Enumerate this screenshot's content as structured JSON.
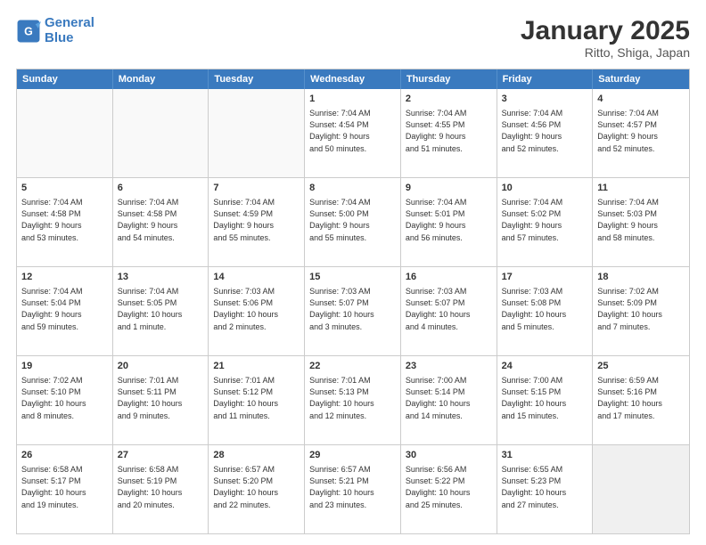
{
  "header": {
    "logo_line1": "General",
    "logo_line2": "Blue",
    "title": "January 2025",
    "subtitle": "Ritto, Shiga, Japan"
  },
  "weekdays": [
    "Sunday",
    "Monday",
    "Tuesday",
    "Wednesday",
    "Thursday",
    "Friday",
    "Saturday"
  ],
  "rows": [
    [
      {
        "day": "",
        "text": "",
        "empty": true
      },
      {
        "day": "",
        "text": "",
        "empty": true
      },
      {
        "day": "",
        "text": "",
        "empty": true
      },
      {
        "day": "1",
        "text": "Sunrise: 7:04 AM\nSunset: 4:54 PM\nDaylight: 9 hours\nand 50 minutes."
      },
      {
        "day": "2",
        "text": "Sunrise: 7:04 AM\nSunset: 4:55 PM\nDaylight: 9 hours\nand 51 minutes."
      },
      {
        "day": "3",
        "text": "Sunrise: 7:04 AM\nSunset: 4:56 PM\nDaylight: 9 hours\nand 52 minutes."
      },
      {
        "day": "4",
        "text": "Sunrise: 7:04 AM\nSunset: 4:57 PM\nDaylight: 9 hours\nand 52 minutes."
      }
    ],
    [
      {
        "day": "5",
        "text": "Sunrise: 7:04 AM\nSunset: 4:58 PM\nDaylight: 9 hours\nand 53 minutes."
      },
      {
        "day": "6",
        "text": "Sunrise: 7:04 AM\nSunset: 4:58 PM\nDaylight: 9 hours\nand 54 minutes."
      },
      {
        "day": "7",
        "text": "Sunrise: 7:04 AM\nSunset: 4:59 PM\nDaylight: 9 hours\nand 55 minutes."
      },
      {
        "day": "8",
        "text": "Sunrise: 7:04 AM\nSunset: 5:00 PM\nDaylight: 9 hours\nand 55 minutes."
      },
      {
        "day": "9",
        "text": "Sunrise: 7:04 AM\nSunset: 5:01 PM\nDaylight: 9 hours\nand 56 minutes."
      },
      {
        "day": "10",
        "text": "Sunrise: 7:04 AM\nSunset: 5:02 PM\nDaylight: 9 hours\nand 57 minutes."
      },
      {
        "day": "11",
        "text": "Sunrise: 7:04 AM\nSunset: 5:03 PM\nDaylight: 9 hours\nand 58 minutes."
      }
    ],
    [
      {
        "day": "12",
        "text": "Sunrise: 7:04 AM\nSunset: 5:04 PM\nDaylight: 9 hours\nand 59 minutes."
      },
      {
        "day": "13",
        "text": "Sunrise: 7:04 AM\nSunset: 5:05 PM\nDaylight: 10 hours\nand 1 minute."
      },
      {
        "day": "14",
        "text": "Sunrise: 7:03 AM\nSunset: 5:06 PM\nDaylight: 10 hours\nand 2 minutes."
      },
      {
        "day": "15",
        "text": "Sunrise: 7:03 AM\nSunset: 5:07 PM\nDaylight: 10 hours\nand 3 minutes."
      },
      {
        "day": "16",
        "text": "Sunrise: 7:03 AM\nSunset: 5:07 PM\nDaylight: 10 hours\nand 4 minutes."
      },
      {
        "day": "17",
        "text": "Sunrise: 7:03 AM\nSunset: 5:08 PM\nDaylight: 10 hours\nand 5 minutes."
      },
      {
        "day": "18",
        "text": "Sunrise: 7:02 AM\nSunset: 5:09 PM\nDaylight: 10 hours\nand 7 minutes."
      }
    ],
    [
      {
        "day": "19",
        "text": "Sunrise: 7:02 AM\nSunset: 5:10 PM\nDaylight: 10 hours\nand 8 minutes."
      },
      {
        "day": "20",
        "text": "Sunrise: 7:01 AM\nSunset: 5:11 PM\nDaylight: 10 hours\nand 9 minutes."
      },
      {
        "day": "21",
        "text": "Sunrise: 7:01 AM\nSunset: 5:12 PM\nDaylight: 10 hours\nand 11 minutes."
      },
      {
        "day": "22",
        "text": "Sunrise: 7:01 AM\nSunset: 5:13 PM\nDaylight: 10 hours\nand 12 minutes."
      },
      {
        "day": "23",
        "text": "Sunrise: 7:00 AM\nSunset: 5:14 PM\nDaylight: 10 hours\nand 14 minutes."
      },
      {
        "day": "24",
        "text": "Sunrise: 7:00 AM\nSunset: 5:15 PM\nDaylight: 10 hours\nand 15 minutes."
      },
      {
        "day": "25",
        "text": "Sunrise: 6:59 AM\nSunset: 5:16 PM\nDaylight: 10 hours\nand 17 minutes."
      }
    ],
    [
      {
        "day": "26",
        "text": "Sunrise: 6:58 AM\nSunset: 5:17 PM\nDaylight: 10 hours\nand 19 minutes."
      },
      {
        "day": "27",
        "text": "Sunrise: 6:58 AM\nSunset: 5:19 PM\nDaylight: 10 hours\nand 20 minutes."
      },
      {
        "day": "28",
        "text": "Sunrise: 6:57 AM\nSunset: 5:20 PM\nDaylight: 10 hours\nand 22 minutes."
      },
      {
        "day": "29",
        "text": "Sunrise: 6:57 AM\nSunset: 5:21 PM\nDaylight: 10 hours\nand 23 minutes."
      },
      {
        "day": "30",
        "text": "Sunrise: 6:56 AM\nSunset: 5:22 PM\nDaylight: 10 hours\nand 25 minutes."
      },
      {
        "day": "31",
        "text": "Sunrise: 6:55 AM\nSunset: 5:23 PM\nDaylight: 10 hours\nand 27 minutes."
      },
      {
        "day": "",
        "text": "",
        "empty": true,
        "shaded": true
      }
    ]
  ]
}
